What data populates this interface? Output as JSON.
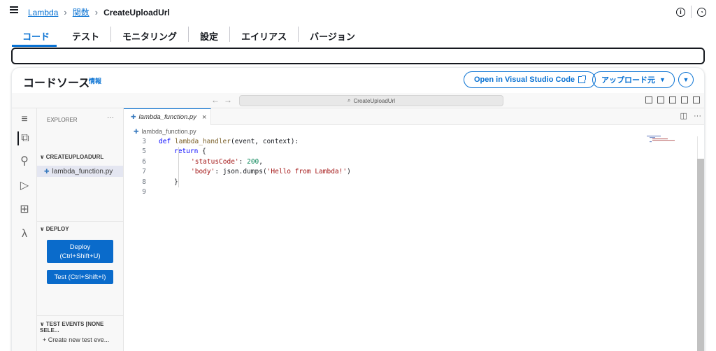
{
  "topbar": {
    "breadcrumb": [
      "Lambda",
      "関数",
      "CreateUploadUrl"
    ],
    "info_icon": "info-icon",
    "settings_icon": "settings-icon"
  },
  "tabs": [
    "コード",
    "テスト",
    "モニタリング",
    "設定",
    "エイリアス",
    "バージョン"
  ],
  "panel": {
    "title": "コードソース",
    "info_link": "情報",
    "open_vscode_label": "Open in Visual Studio Code",
    "upload_label": "アップロード元",
    "dropdown_icon": "chevron-down-icon"
  },
  "ide": {
    "search_text": "CreateUploadUrl",
    "explorer_header": "EXPLORER",
    "explorer_dots": "···",
    "folder_name": "CREATEUPLOADURL",
    "file_name": "lambda_function.py",
    "deploy_section": "DEPLOY",
    "deploy_button_line1": "Deploy",
    "deploy_button_line2": "(Ctrl+Shift+U)",
    "test_button": "Test (Ctrl+Shift+I)",
    "test_events_section": "TEST EVENTS [NONE SELE...",
    "create_test_event": "Create new test eve...",
    "editor_tab": "lambda_function.py",
    "editor_breadcrumb": "lambda_function.py"
  },
  "code": {
    "line_numbers": [
      "3",
      "5",
      "6",
      "7",
      "8",
      "9"
    ]
  },
  "colors": {
    "accent": "#0972d3",
    "button_bg": "#0a6bcb"
  }
}
